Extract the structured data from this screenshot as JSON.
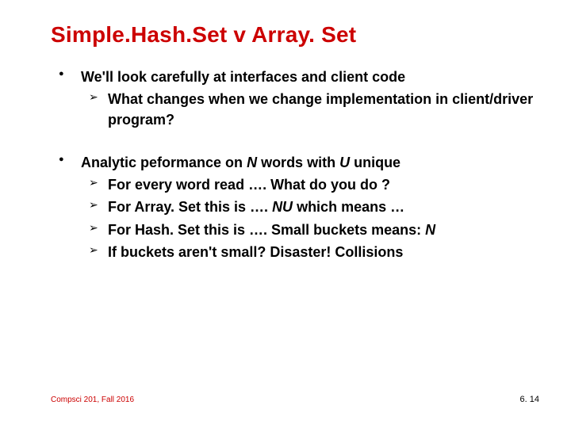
{
  "title": "Simple.Hash.Set v Array. Set",
  "bullets": [
    {
      "text": "We'll look carefully at interfaces and client code",
      "sub": [
        "What changes when we change implementation in client/driver program?"
      ]
    },
    {
      "text_html": "Analytic peformance on <span class=\"italic\">N</span> words with <span class=\"italic\">U</span> unique",
      "sub_html": [
        "For every word read …. What do you do ?",
        "For Array. Set this is …. <span class=\"italic\">NU</span> which means …",
        "For Hash. Set this is …. Small buckets means: <span class=\"italic\">N</span>",
        "If buckets aren't small?  Disaster! Collisions"
      ]
    }
  ],
  "footer": {
    "left": "Compsci 201, Fall 2016",
    "right": "6. 14"
  }
}
